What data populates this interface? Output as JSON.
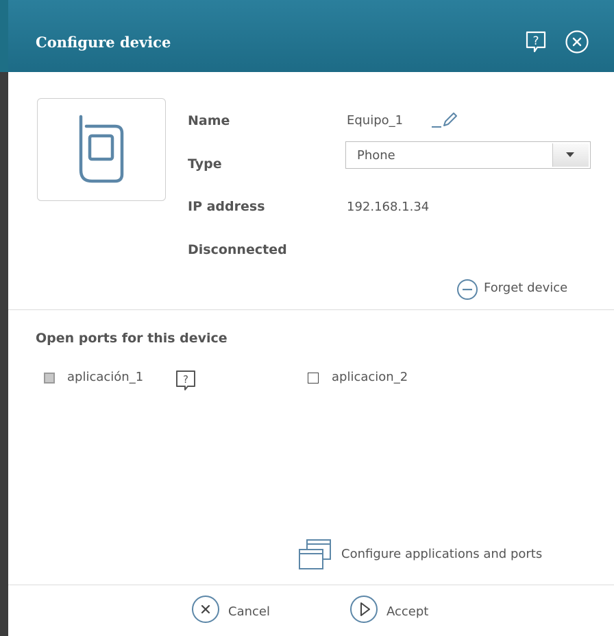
{
  "colors": {
    "header_top": "#2b7f9c",
    "header_bottom": "#1d6b86",
    "icon_blue": "#5c87a8",
    "text": "#555555"
  },
  "dialog": {
    "title": "Configure device",
    "help_icon": "help-icon",
    "close_icon": "close-icon"
  },
  "device": {
    "icon": "phone-icon",
    "name_label": "Name",
    "name_value": "Equipo_1",
    "type_label": "Type",
    "type_value": "Phone",
    "ip_label": "IP address",
    "ip_value": "192.168.1.34",
    "status": "Disconnected",
    "forget_label": "Forget device"
  },
  "ports": {
    "title": "Open ports for this device",
    "apps": [
      {
        "label": "aplicación_1",
        "checked": false,
        "disabled": true
      },
      {
        "label": "aplicacion_2",
        "checked": false,
        "disabled": false
      }
    ],
    "configure_label": "Configure applications and ports"
  },
  "footer": {
    "cancel_label": "Cancel",
    "accept_label": "Accept"
  }
}
